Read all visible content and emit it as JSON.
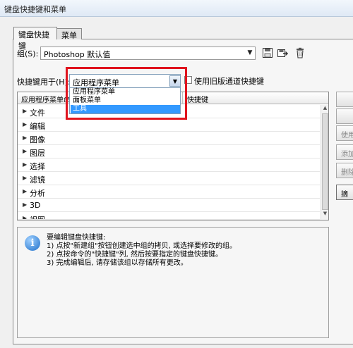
{
  "window": {
    "title": "键盘快捷键和菜单"
  },
  "tabs": [
    {
      "label": "键盘快捷键"
    },
    {
      "label": "菜单"
    }
  ],
  "group": {
    "label": "组(S):",
    "value": "Photoshop 默认值"
  },
  "shortcuts_for": {
    "label": "快捷键用于(H):",
    "value": "应用程序菜单",
    "options": [
      "应用程序菜单",
      "面板菜单",
      "工具"
    ],
    "highlighted": "工具",
    "highlight_color": "#3399ff"
  },
  "legacy_channel": {
    "label": "使用旧版通道快捷键",
    "checked": false
  },
  "table": {
    "columns": [
      "应用程序菜单命令",
      "快捷键"
    ],
    "rows": [
      "文件",
      "编辑",
      "图像",
      "图层",
      "选择",
      "滤镜",
      "分析",
      "3D",
      "视图"
    ]
  },
  "side_buttons": {
    "use": "使用",
    "add": "添加",
    "delete": "删除",
    "summary": "摘"
  },
  "info": {
    "lines": [
      "要编辑键盘快捷键:",
      "1) 点按\"新建组\"按钮创建选中组的拷贝, 或选择要修改的组。",
      "2) 点按命令的\"快捷键\"列, 然后按要指定的键盘快捷键。",
      "3) 完成编辑后, 请存储该组以存储所有更改。"
    ]
  },
  "annotation": {
    "color": "#e0141e"
  },
  "icons": [
    "save-icon",
    "save-as-icon",
    "delete-icon",
    "info-icon"
  ]
}
